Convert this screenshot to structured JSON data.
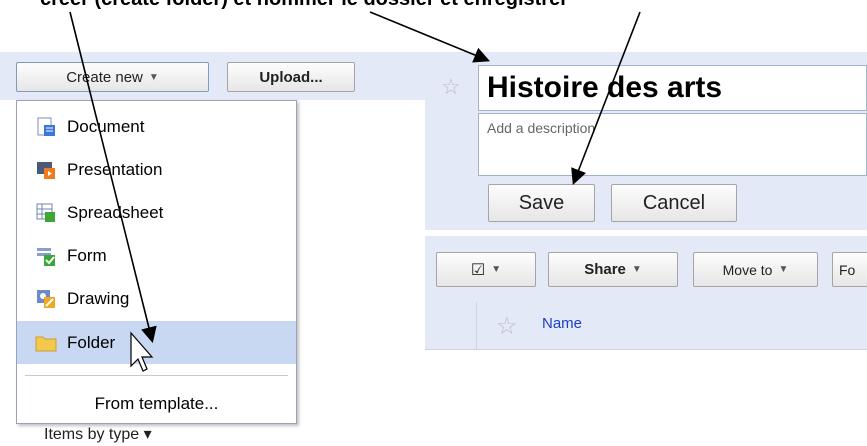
{
  "caption": "créer (create folder) et nommer le dossier et enregistrer",
  "left_panel": {
    "create_new_label": "Create new",
    "upload_label": "Upload...",
    "menu_items": [
      {
        "label": "Document",
        "icon": "document-icon"
      },
      {
        "label": "Presentation",
        "icon": "presentation-icon"
      },
      {
        "label": "Spreadsheet",
        "icon": "spreadsheet-icon"
      },
      {
        "label": "Form",
        "icon": "form-icon"
      },
      {
        "label": "Drawing",
        "icon": "drawing-icon"
      },
      {
        "label": "Folder",
        "icon": "folder-icon",
        "hovered": true
      }
    ],
    "from_template_label": "From template...",
    "behind_text": "Items by type"
  },
  "right_panel": {
    "title_value": "Histoire des arts",
    "description_placeholder": "Add a description",
    "save_label": "Save",
    "cancel_label": "Cancel",
    "toolbar": {
      "check_label": "☑",
      "share_label": "Share",
      "move_label": "Move to",
      "next_label": "Fo"
    },
    "list_header": {
      "name_label": "Name"
    }
  },
  "colors": {
    "panel_bg": "#e4e9f7",
    "menu_hover": "#c8d8f2",
    "link": "#1a3ec9"
  }
}
